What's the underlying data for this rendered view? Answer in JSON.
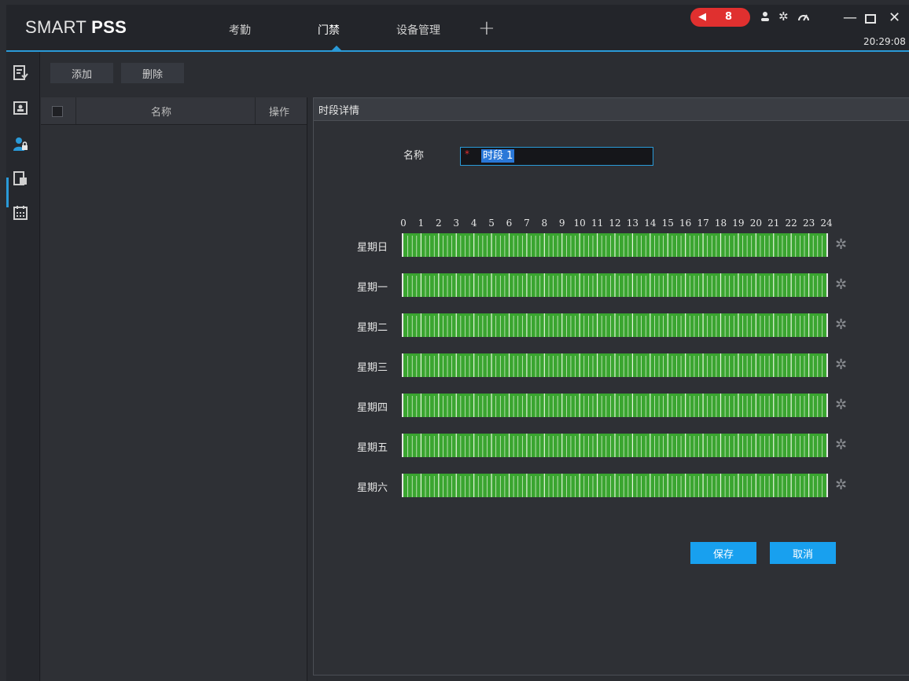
{
  "app": {
    "brand_light": "SMART ",
    "brand_bold": "PSS"
  },
  "tabs": [
    {
      "label": "考勤",
      "active": false
    },
    {
      "label": "门禁",
      "active": true
    },
    {
      "label": "设备管理",
      "active": false
    }
  ],
  "tab_add_label": "+",
  "alarm": {
    "count": "8"
  },
  "clock": "20:29:08",
  "toolbar": {
    "add_label": "添加",
    "delete_label": "删除"
  },
  "list": {
    "col_name": "名称",
    "col_op": "操作"
  },
  "detail": {
    "title": "时段详情",
    "name_label": "名称",
    "name_required_mark": "*",
    "name_value": "时段 1",
    "hours": [
      "0",
      "1",
      "2",
      "3",
      "4",
      "5",
      "6",
      "7",
      "8",
      "9",
      "10",
      "11",
      "12",
      "13",
      "14",
      "15",
      "16",
      "17",
      "18",
      "19",
      "20",
      "21",
      "22",
      "23",
      "24"
    ],
    "days": [
      "星期日",
      "星期一",
      "星期二",
      "星期三",
      "星期四",
      "星期五",
      "星期六"
    ],
    "save_label": "保存",
    "cancel_label": "取消"
  },
  "colors": {
    "accent": "#2a9ad8",
    "track_green": "#3aa530",
    "alarm_red": "#e0302f",
    "button_blue": "#18a0ef"
  },
  "icons": {
    "rail": [
      "attendance-report-icon",
      "person-card-icon",
      "access-user-icon",
      "door-record-icon",
      "calendar-icon"
    ],
    "titlebar": [
      "speaker-icon",
      "user-icon",
      "settings-icon",
      "performance-icon",
      "minimize-icon",
      "maximize-icon",
      "close-icon"
    ]
  }
}
